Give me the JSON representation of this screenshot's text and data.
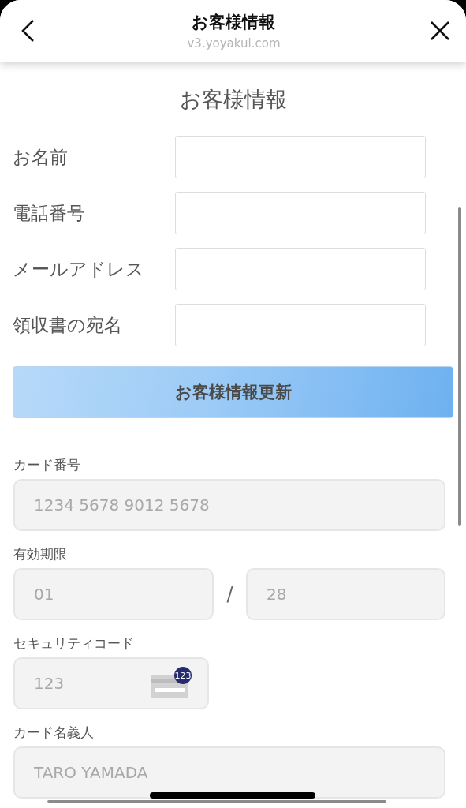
{
  "header": {
    "title": "お客様情報",
    "url": "v3.yoyakul.com"
  },
  "heading": "お客様情報",
  "customer_fields": [
    {
      "label": "お名前"
    },
    {
      "label": "電話番号"
    },
    {
      "label": "メールアドレス"
    },
    {
      "label": "領収書の宛名"
    }
  ],
  "update_button": "お客様情報更新",
  "card": {
    "number": {
      "label": "カード番号",
      "placeholder": "1234 5678 9012 5678"
    },
    "expiry": {
      "label": "有効期限",
      "month_placeholder": "01",
      "separator": "/",
      "year_placeholder": "28"
    },
    "security": {
      "label": "セキュリティコード",
      "placeholder": "123",
      "icon_badge": "123"
    },
    "holder": {
      "label": "カード名義人",
      "placeholder": "TARO YAMADA"
    }
  }
}
